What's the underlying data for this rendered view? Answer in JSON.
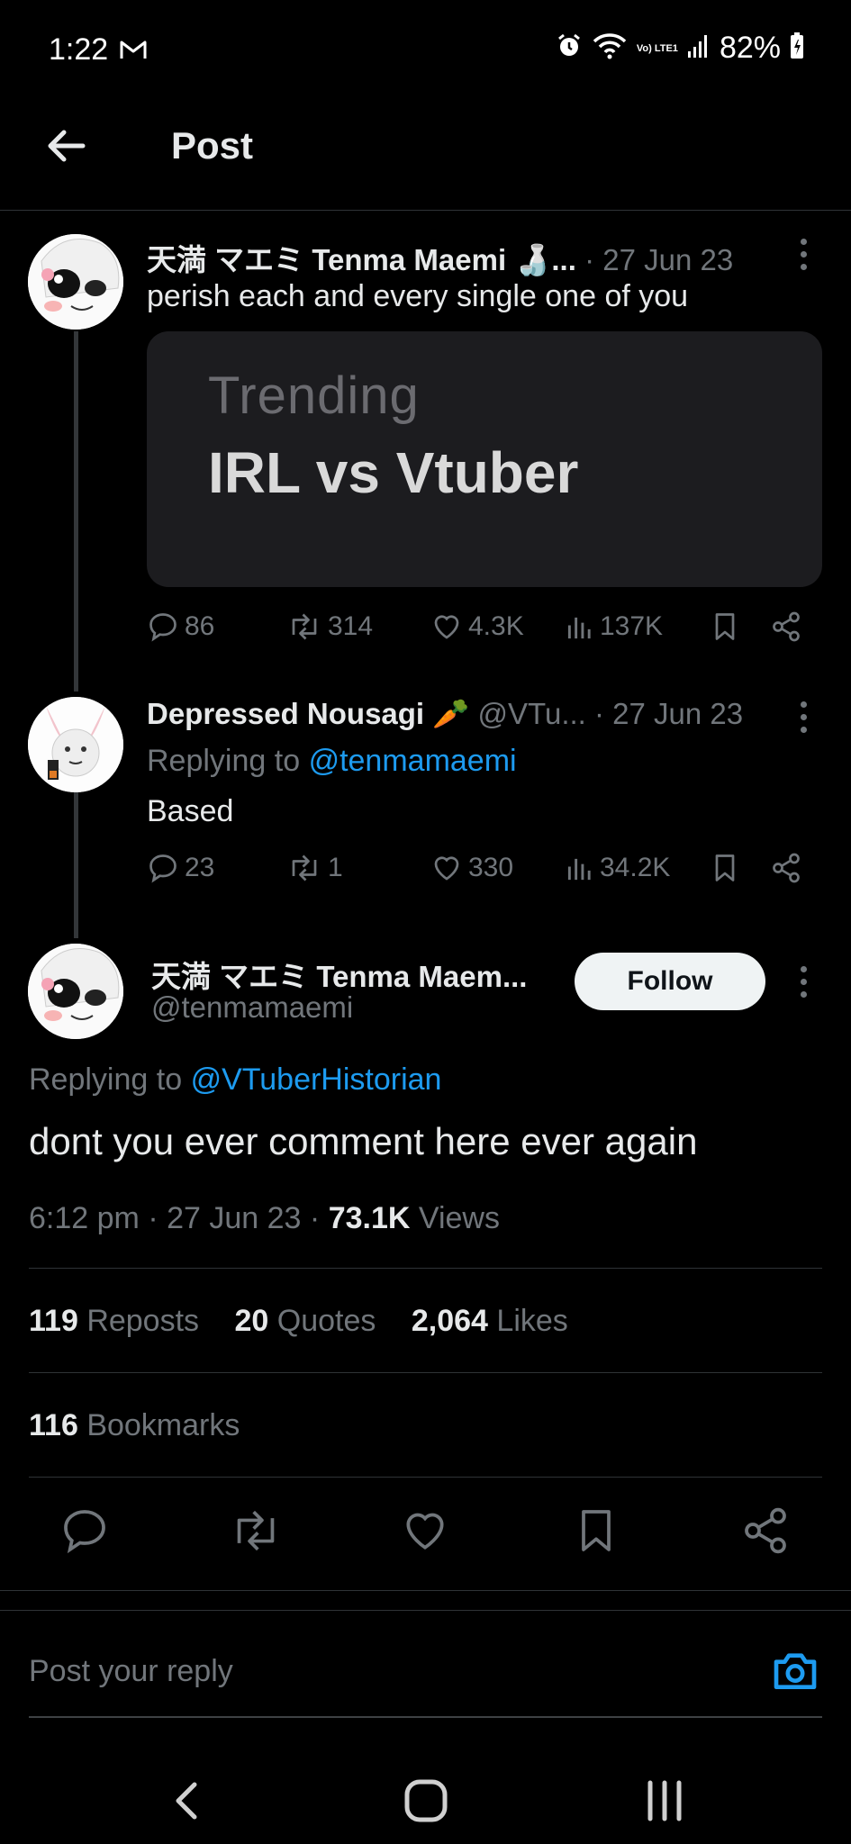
{
  "status_bar": {
    "time": "1:22",
    "battery": "82%",
    "network": "Vo) LTE1"
  },
  "header": {
    "title": "Post"
  },
  "tweet1": {
    "display_name": "天満 マエミ Tenma Maemi 🍶...",
    "date": "· 27 Jun 23",
    "text": "perish each and every single one of you",
    "card_label": "Trending",
    "card_title": "IRL vs Vtuber",
    "replies": "86",
    "reposts": "314",
    "likes": "4.3K",
    "views": "137K"
  },
  "tweet2": {
    "display_name": "Depressed Nousagi 🥕",
    "handle": "@VTu...",
    "date": "· 27 Jun 23",
    "replying_prefix": "Replying to",
    "replying_handle": "@tenmamaemi",
    "text": "Based",
    "replies": "23",
    "reposts": "1",
    "likes": "330",
    "views": "34.2K"
  },
  "main_tweet": {
    "display_name": "天満 マエミ Tenma Maem...",
    "handle": "@tenmamaemi",
    "follow_label": "Follow",
    "replying_prefix": "Replying to",
    "replying_handle": "@VTuberHistorian",
    "text": "dont you ever comment here ever again",
    "time": "6:12 pm",
    "date": "27 Jun 23",
    "views_count": "73.1K",
    "views_label": "Views",
    "sep": "·",
    "reposts_count": "119",
    "reposts_label": "Reposts",
    "quotes_count": "20",
    "quotes_label": "Quotes",
    "likes_count": "2,064",
    "likes_label": "Likes",
    "bookmarks_count": "116",
    "bookmarks_label": "Bookmarks"
  },
  "reply_bar": {
    "placeholder": "Post your reply"
  },
  "colors": {
    "background": "#000000",
    "text": "#e7e9ea",
    "secondary": "#71767b",
    "link": "#1d9bf0",
    "divider": "#2f3336"
  },
  "icons": {
    "back": "arrow-left-icon",
    "reply": "chat-bubble-icon",
    "repost": "repost-icon",
    "like": "heart-icon",
    "views": "bar-chart-icon",
    "bookmark": "bookmark-icon",
    "share": "share-icon",
    "camera": "camera-icon"
  }
}
